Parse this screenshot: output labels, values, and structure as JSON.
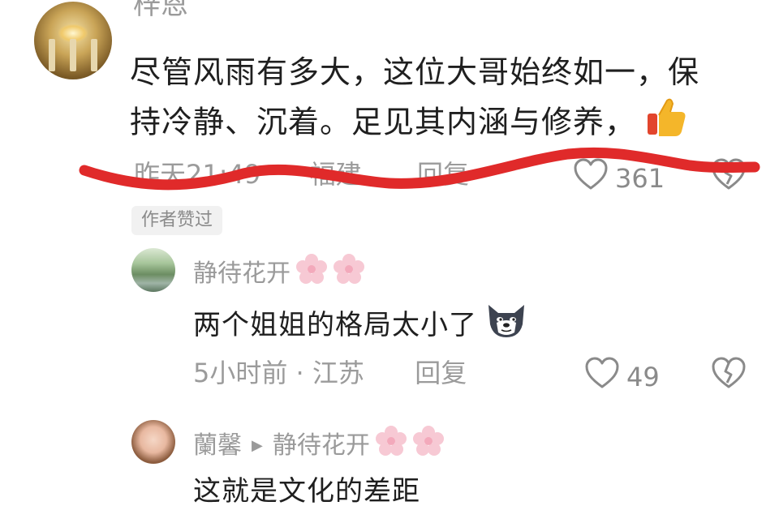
{
  "main_comment": {
    "username": "梓恩",
    "text_line1": "尽管风雨有多大，这位大哥始终如一，保",
    "text_line2": "持冷静、沉着。足见其内涵与修养，",
    "emoji": "thumbs-up-icon",
    "time": "昨天21:49",
    "location": "福建",
    "reply_label": "回复",
    "likes": "361",
    "author_liked_badge": "作者赞过"
  },
  "replies": [
    {
      "username": "静待花开",
      "text": "两个姐姐的格局太小了",
      "emoji": "dog-face-icon",
      "time": "5小时前 · 江苏",
      "reply_label": "回复",
      "likes": "49"
    },
    {
      "username": "蘭馨",
      "reply_to": "静待花开",
      "text": "这就是文化的差距"
    }
  ],
  "colors": {
    "text_primary": "#1f1f1f",
    "text_secondary": "#9a9a9a",
    "scribble_red": "#e02a2a",
    "badge_bg": "#f1f1f1"
  }
}
